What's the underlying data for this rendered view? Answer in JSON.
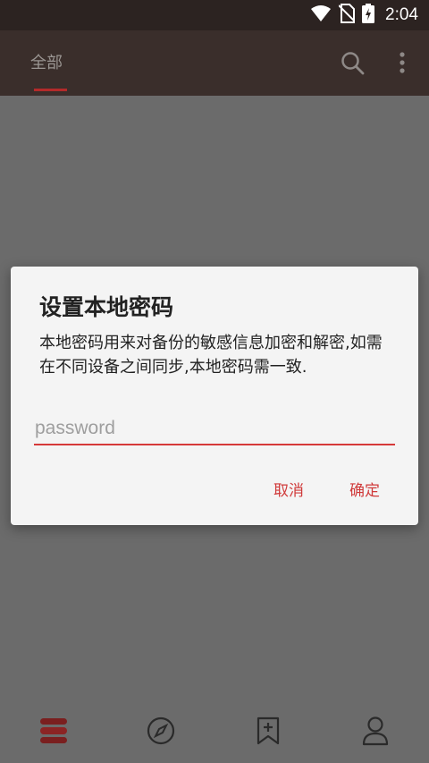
{
  "status_bar": {
    "time": "2:04",
    "icons": [
      "wifi-icon",
      "no-sim-icon",
      "battery-charging-icon"
    ]
  },
  "app_bar": {
    "tabs": [
      {
        "label": "全部",
        "selected": true
      }
    ],
    "actions": [
      "search-icon",
      "more-vert-icon"
    ]
  },
  "dialog": {
    "title": "设置本地密码",
    "message": "本地密码用来对备份的敏感信息加密和解密,如需在不同设备之间同步,本地密码需一致.",
    "input": {
      "placeholder": "password",
      "value": ""
    },
    "buttons": {
      "cancel": "取消",
      "ok": "确定"
    }
  },
  "bottom_nav": {
    "items": [
      {
        "icon": "bookshelf-icon",
        "selected": true
      },
      {
        "icon": "compass-icon",
        "selected": false
      },
      {
        "icon": "bookmark-add-icon",
        "selected": false
      },
      {
        "icon": "person-icon",
        "selected": false
      }
    ]
  },
  "colors": {
    "status_bar": "#2c2321",
    "app_bar": "#3a2e2b",
    "accent": "#d03a3a",
    "scrim_background": "#6b6b6b",
    "dialog_background": "#f4f4f4"
  }
}
